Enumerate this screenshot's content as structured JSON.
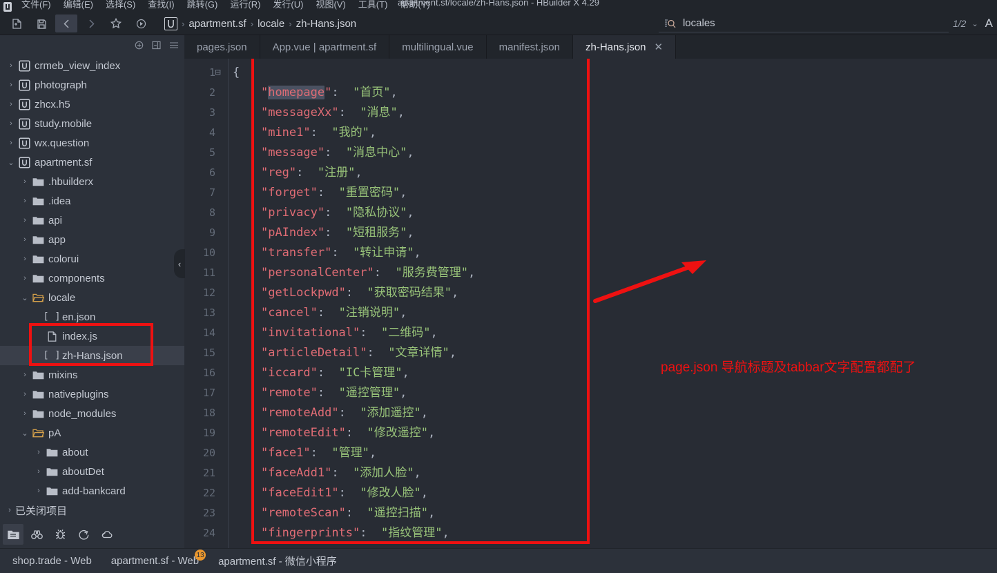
{
  "window": {
    "title": "apartment.sf/locale/zh-Hans.json - HBuilder X 4.29",
    "menu": [
      "文件(F)",
      "编辑(E)",
      "选择(S)",
      "查找(I)",
      "跳转(G)",
      "运行(R)",
      "发行(U)",
      "视图(V)",
      "工具(T)",
      "帮助(Y)"
    ]
  },
  "toolbar": {
    "icons": [
      "new-file-icon",
      "save-icon",
      "back-icon",
      "forward-icon",
      "star-icon",
      "run-icon"
    ],
    "breadcrumb": {
      "logo": "U",
      "items": [
        "apartment.sf",
        "locale",
        "zh-Hans.json"
      ],
      "separator": "›"
    },
    "search": {
      "icon": "search-icon",
      "value": "locales",
      "placeholder": "locales"
    },
    "pager": "1/2",
    "caret": "⌄",
    "right_letter": "A"
  },
  "sidebar": {
    "header_icons": [
      "add-icon",
      "collapse-panel-icon",
      "menu-icon"
    ],
    "tree": [
      {
        "label": "crmeb_view_index",
        "icon": "project-icon",
        "twisty": "›",
        "indent": 0
      },
      {
        "label": "photograph",
        "icon": "project-icon",
        "twisty": "›",
        "indent": 0
      },
      {
        "label": "zhcx.h5",
        "icon": "project-icon",
        "twisty": "›",
        "indent": 0
      },
      {
        "label": "study.mobile",
        "icon": "project-icon",
        "twisty": "›",
        "indent": 0
      },
      {
        "label": "wx.question",
        "icon": "project-icon",
        "twisty": "›",
        "indent": 0
      },
      {
        "label": "apartment.sf",
        "icon": "project-icon",
        "twisty": "⌄",
        "indent": 0
      },
      {
        "label": ".hbuilderx",
        "icon": "folder-icon",
        "twisty": "›",
        "indent": 1
      },
      {
        "label": ".idea",
        "icon": "folder-icon",
        "twisty": "›",
        "indent": 1
      },
      {
        "label": "api",
        "icon": "folder-icon",
        "twisty": "›",
        "indent": 1
      },
      {
        "label": "app",
        "icon": "folder-icon",
        "twisty": "›",
        "indent": 1
      },
      {
        "label": "colorui",
        "icon": "folder-icon",
        "twisty": "›",
        "indent": 1
      },
      {
        "label": "components",
        "icon": "folder-icon",
        "twisty": "›",
        "indent": 1
      },
      {
        "label": "locale",
        "icon": "folder-open-icon",
        "twisty": "⌄",
        "indent": 1
      },
      {
        "label": "en.json",
        "icon": "json-file-icon",
        "twisty": "",
        "indent": 2
      },
      {
        "label": "index.js",
        "icon": "js-file-icon",
        "twisty": "",
        "indent": 2
      },
      {
        "label": "zh-Hans.json",
        "icon": "json-file-icon",
        "twisty": "",
        "indent": 2,
        "selected": true
      },
      {
        "label": "mixins",
        "icon": "folder-icon",
        "twisty": "›",
        "indent": 1
      },
      {
        "label": "nativeplugins",
        "icon": "folder-icon",
        "twisty": "›",
        "indent": 1
      },
      {
        "label": "node_modules",
        "icon": "folder-icon",
        "twisty": "›",
        "indent": 1
      },
      {
        "label": "pA",
        "icon": "folder-open-icon",
        "twisty": "⌄",
        "indent": 1
      },
      {
        "label": "about",
        "icon": "folder-icon",
        "twisty": "›",
        "indent": 2
      },
      {
        "label": "aboutDet",
        "icon": "folder-icon",
        "twisty": "›",
        "indent": 2
      },
      {
        "label": "add-bankcard",
        "icon": "folder-icon",
        "twisty": "›",
        "indent": 2
      }
    ],
    "closed_projects": {
      "label": "已关闭项目",
      "twisty": "›"
    },
    "bottom_icons": [
      "explorer-icon",
      "search-binoculars-icon",
      "debug-bug-icon",
      "run-arrow-icon",
      "cloud-icon"
    ]
  },
  "tabs": [
    {
      "label": "pages.json",
      "active": false,
      "closable": false
    },
    {
      "label": "App.vue | apartment.sf",
      "active": false,
      "closable": false
    },
    {
      "label": "multilingual.vue",
      "active": false,
      "closable": false
    },
    {
      "label": "manifest.json",
      "active": false,
      "closable": false
    },
    {
      "label": "zh-Hans.json",
      "active": true,
      "closable": true,
      "close_glyph": "✕"
    }
  ],
  "editor": {
    "fold_marker": "⊟",
    "lines": [
      {
        "n": 1,
        "brace": "{"
      },
      {
        "n": 2,
        "key": "homepage",
        "value": "首页",
        "selected": true
      },
      {
        "n": 3,
        "key": "messageXx",
        "value": "消息"
      },
      {
        "n": 4,
        "key": "mine1",
        "value": "我的"
      },
      {
        "n": 5,
        "key": "message",
        "value": "消息中心"
      },
      {
        "n": 6,
        "key": "reg",
        "value": "注册"
      },
      {
        "n": 7,
        "key": "forget",
        "value": "重置密码"
      },
      {
        "n": 8,
        "key": "privacy",
        "value": "隐私协议"
      },
      {
        "n": 9,
        "key": "pAIndex",
        "value": "短租服务"
      },
      {
        "n": 10,
        "key": "transfer",
        "value": "转让申请"
      },
      {
        "n": 11,
        "key": "personalCenter",
        "value": "服务费管理"
      },
      {
        "n": 12,
        "key": "getLockpwd",
        "value": "获取密码结果"
      },
      {
        "n": 13,
        "key": "cancel",
        "value": "注销说明"
      },
      {
        "n": 14,
        "key": "invitational",
        "value": "二维码"
      },
      {
        "n": 15,
        "key": "articleDetail",
        "value": "文章详情"
      },
      {
        "n": 16,
        "key": "iccard",
        "value": "IC卡管理"
      },
      {
        "n": 17,
        "key": "remote",
        "value": "遥控管理"
      },
      {
        "n": 18,
        "key": "remoteAdd",
        "value": "添加遥控"
      },
      {
        "n": 19,
        "key": "remoteEdit",
        "value": "修改遥控"
      },
      {
        "n": 20,
        "key": "face1",
        "value": "管理"
      },
      {
        "n": 21,
        "key": "faceAdd1",
        "value": "添加人脸"
      },
      {
        "n": 22,
        "key": "faceEdit1",
        "value": "修改人脸"
      },
      {
        "n": 23,
        "key": "remoteScan",
        "value": "遥控扫描"
      },
      {
        "n": 24,
        "key": "fingerprints",
        "value": "指纹管理"
      }
    ]
  },
  "annotation": {
    "text": "page.json 导航标题及tabbar文字配置都配了",
    "color": "#ee1111",
    "arrow": "arrow-icon"
  },
  "statusbar": {
    "items": [
      {
        "label": "shop.trade - Web",
        "badge": ""
      },
      {
        "label": "apartment.sf - Web",
        "badge": "13"
      },
      {
        "label": "apartment.sf - 微信小程序",
        "badge": ""
      }
    ]
  }
}
